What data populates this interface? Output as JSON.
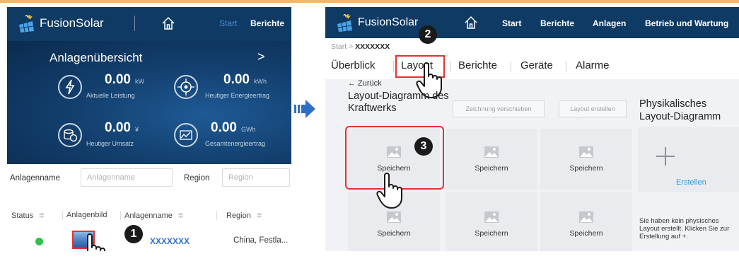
{
  "left_panel": {
    "brand": "FusionSolar",
    "nav": {
      "start": "Start",
      "berichte": "Berichte"
    },
    "overview_title": "Anlagenübersicht",
    "chevron": ">",
    "stats": [
      {
        "value": "0.00",
        "unit": "kW",
        "label": "Aktuelle Leistung",
        "icon": "lightning-icon"
      },
      {
        "value": "0.00",
        "unit": "kWh",
        "label": "Heutiger Energieertrag",
        "icon": "energy-target-icon"
      },
      {
        "value": "0.00",
        "unit": "¥",
        "label": "Heutiger Umsatz",
        "icon": "coins-icon"
      },
      {
        "value": "0.00",
        "unit": "GWh",
        "label": "Gesamtenergieertrag",
        "icon": "chart-trend-icon"
      }
    ],
    "filters": {
      "name_label": "Anlagenname",
      "name_placeholder": "Anlagenname",
      "region_label": "Region",
      "region_placeholder": "Region"
    },
    "table": {
      "headers": [
        "Status",
        "Anlagenbild",
        "Anlagenname",
        "Region"
      ],
      "sort_glyph": "≑",
      "row": {
        "name": "XXXXXXX",
        "region": "China, Festla..."
      }
    }
  },
  "right_panel": {
    "brand": "FusionSolar",
    "nav": [
      "Start",
      "Berichte",
      "Anlagen",
      "Betrieb und Wartung"
    ],
    "breadcrumb": {
      "root": "Start",
      "sep": ">",
      "current": "XXXXXXX"
    },
    "tabs": [
      "Überblick",
      "Layout",
      "Berichte",
      "Geräte",
      "Alarme"
    ],
    "back": "← Zurück",
    "diagram_title": "Layout-Diagramm des Kraftwerks",
    "buttons": {
      "move": "Zeichnung verschieben",
      "create_layout": "Layout erstellen"
    },
    "physical_title": "Physikalisches Layout-Diagramm",
    "card_label": "Speichern",
    "plus_glyph": "+",
    "create_label": "Erstellen",
    "hint": "Sie haben kein physisches Layout erstellt. Klicken Sie zur Erstellung auf +."
  },
  "steps": [
    "1",
    "2",
    "3"
  ],
  "colors": {
    "header": "#0e3a64",
    "highlight": "#e23232",
    "link": "#2f73c9",
    "status_ok": "#2fc14a",
    "arrow": "#2d6fc4"
  }
}
